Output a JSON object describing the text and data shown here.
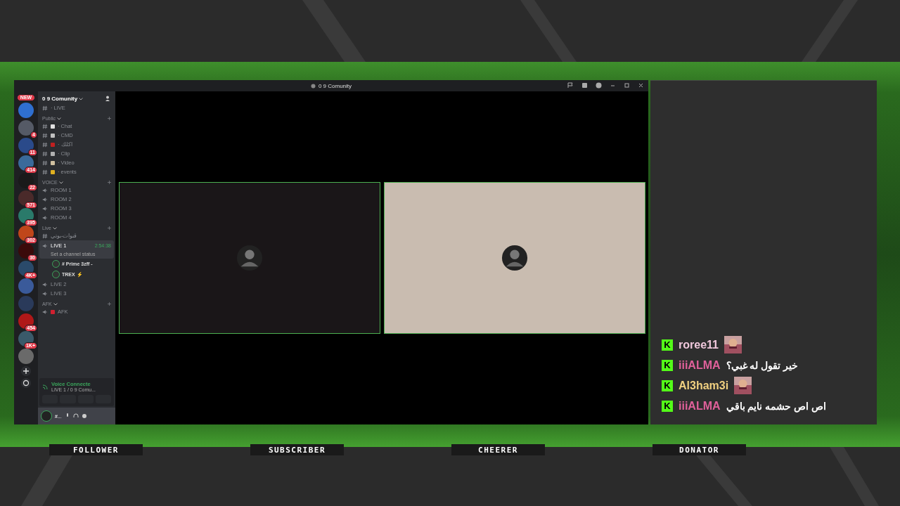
{
  "window": {
    "title": "0 9 Comunity"
  },
  "servers": [
    {
      "badge": "NEW",
      "color": "#2f6fd0"
    },
    {
      "badge": "4",
      "color": "#555a66"
    },
    {
      "badge": "11",
      "color": "#2a4a8a"
    },
    {
      "badge": "414",
      "color": "#3a6a9a"
    },
    {
      "badge": "22",
      "color": "#1a1a1a"
    },
    {
      "badge": "571",
      "color": "#4a2a2a"
    },
    {
      "badge": "395",
      "color": "#2a7a6a"
    },
    {
      "badge": "302",
      "color": "#c0461a"
    },
    {
      "badge": "30",
      "color": "#3a0a0a"
    },
    {
      "badge": "4K+",
      "color": "#2a4a6a"
    },
    {
      "color": "#3a5a9a"
    },
    {
      "color": "#2a3a5a"
    },
    {
      "badge": "454",
      "color": "#b01818"
    },
    {
      "badge": "1K+",
      "color": "#3a5a6a"
    },
    {
      "color": "#6a6a6a"
    }
  ],
  "server_name": "0 9 Comunity",
  "top_channel": "· LIVE",
  "categories": [
    {
      "name": "Public",
      "channels": [
        {
          "kind": "text",
          "name": "· Chat",
          "color": "#e0e0e0"
        },
        {
          "kind": "text",
          "name": "· CMD",
          "color": "#c0c0c0"
        },
        {
          "kind": "text",
          "name": "· اكلك",
          "color": "#c02020"
        },
        {
          "kind": "text",
          "name": "· Clip",
          "color": "#b0b0b0"
        },
        {
          "kind": "text",
          "name": "· Video",
          "color": "#d0c0a0"
        },
        {
          "kind": "text",
          "name": "· events",
          "color": "#e0b020"
        }
      ]
    },
    {
      "name": "VOICE",
      "channels": [
        {
          "kind": "voice",
          "name": "ROOM 1"
        },
        {
          "kind": "voice",
          "name": "ROOM 2"
        },
        {
          "kind": "voice",
          "name": "ROOM 3"
        },
        {
          "kind": "voice",
          "name": "ROOM 4"
        }
      ]
    },
    {
      "name": "Live",
      "channels": [
        {
          "kind": "text",
          "name": "قنوات-بوتي"
        },
        {
          "kind": "voice",
          "name": "LIVE 1",
          "selected": true,
          "timer": "2:54:38",
          "status": "Set a channel status",
          "members": [
            "# Prime 3zff -",
            "TREX ⚡"
          ]
        },
        {
          "kind": "voice",
          "name": "LIVE 2",
          "selected": false
        },
        {
          "kind": "voice",
          "name": "LIVE 3",
          "selected": false
        }
      ]
    },
    {
      "name": "AFK",
      "channels": [
        {
          "kind": "voice",
          "name": "AFK",
          "color": "#d02030"
        }
      ]
    }
  ],
  "voice_panel": {
    "title": "Voice Connecte",
    "subtitle": "LIVE 1 / 0 9 Comu..."
  },
  "user_panel": {
    "name": "#..."
  },
  "tiles": [
    {
      "kind": "camera-off"
    },
    {
      "kind": "camera-off"
    }
  ],
  "chat": [
    {
      "badge": "K",
      "user": "roree11",
      "color": "#f0c8dc",
      "kind": "emote"
    },
    {
      "badge": "K",
      "user": "iiiALMA",
      "color": "#e0609a",
      "kind": "text",
      "text": "خير تقول له غبي؟"
    },
    {
      "badge": "K",
      "user": "Al3ham3i",
      "color": "#f0d080",
      "kind": "emote"
    },
    {
      "badge": "K",
      "user": "iiiALMA",
      "color": "#e0609a",
      "kind": "text",
      "text": "اص اص حشمه نايم باقي"
    }
  ],
  "labels": [
    "FOLLOWER",
    "SUBSCRIBER",
    "CHEERER",
    "DONATOR"
  ]
}
